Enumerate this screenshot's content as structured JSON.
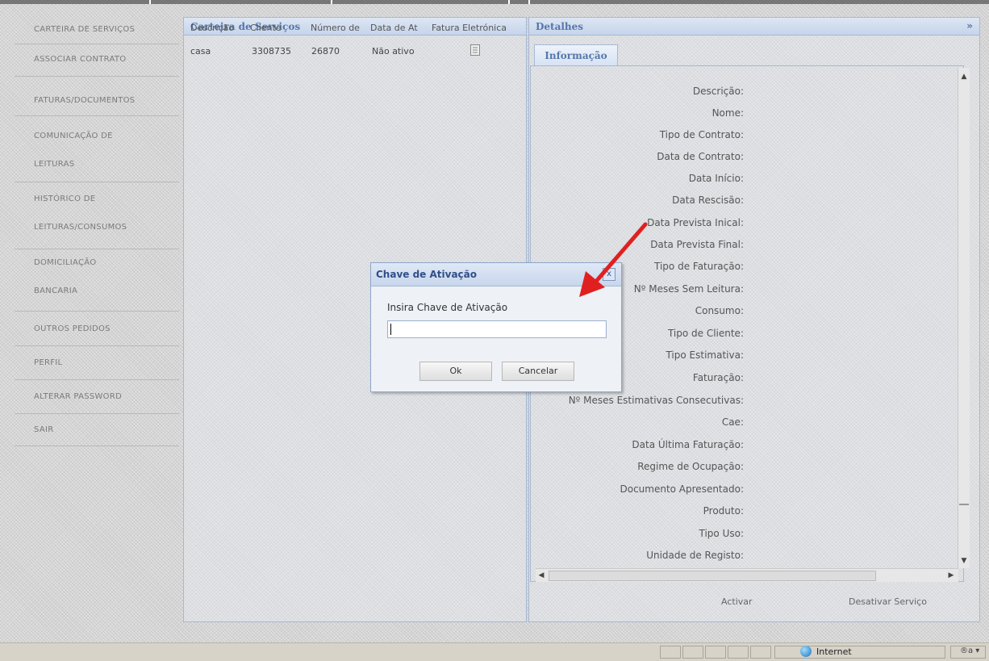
{
  "nav": {
    "items": [
      {
        "label": "CARTEIRA DE SERVIÇOS"
      },
      {
        "label": "ASSOCIAR CONTRATO"
      },
      {
        "label": "FATURAS/DOCUMENTOS"
      },
      {
        "label": "COMUNICAÇÃO DE",
        "label2": "LEITURAS"
      },
      {
        "label": "HISTÓRICO DE",
        "label2": "LEITURAS/CONSUMOS"
      },
      {
        "label": "DOMICILIAÇÃO",
        "label2": "BANCARIA"
      },
      {
        "label": "OUTROS PEDIDOS"
      },
      {
        "label": "PERFIL"
      },
      {
        "label": "ALTERAR PASSWORD"
      },
      {
        "label": "SAIR"
      }
    ]
  },
  "services": {
    "title": "Carteira de Serviços",
    "columns": [
      "Descrição",
      "Cliente",
      "Número de",
      "Data de At",
      "Fatura Eletrónica"
    ],
    "rows": [
      {
        "descricao": "casa",
        "cliente": "3308735",
        "numero": "26870",
        "data": "Não ativo",
        "fatura_icon": "document-icon"
      }
    ]
  },
  "details": {
    "title": "Detalhes",
    "collapse_glyph": "»",
    "tab": "Informação",
    "fields": [
      "Descrição:",
      "Nome:",
      "Tipo de Contrato:",
      "Data de Contrato:",
      "Data Início:",
      "Data Rescisão:",
      "Data Prevista Inical:",
      "Data Prevista Final:",
      "Tipo de Faturação:",
      "Nº Meses Sem Leitura:",
      "Consumo:",
      "Tipo de Cliente:",
      "Tipo Estimativa:",
      "Faturação:",
      "Nº Meses Estimativas Consecutivas:",
      "Cae:",
      "Data Última Faturação:",
      "Regime de Ocupação:",
      "Documento Apresentado:",
      "Produto:",
      "Tipo Uso:",
      "Unidade de Registo:"
    ],
    "buttons": {
      "activate": "Activar",
      "deactivate": "Desativar Serviço"
    }
  },
  "dialog": {
    "title": "Chave de Ativação",
    "close_glyph": "x",
    "label": "Insira Chave de Ativação",
    "input_value": "",
    "ok": "Ok",
    "cancel": "Cancelar"
  },
  "statusbar": {
    "zone": "Internet",
    "zoom": "®a ▾"
  },
  "colors": {
    "accent": "#5577aa",
    "pointer": "#e02020"
  }
}
